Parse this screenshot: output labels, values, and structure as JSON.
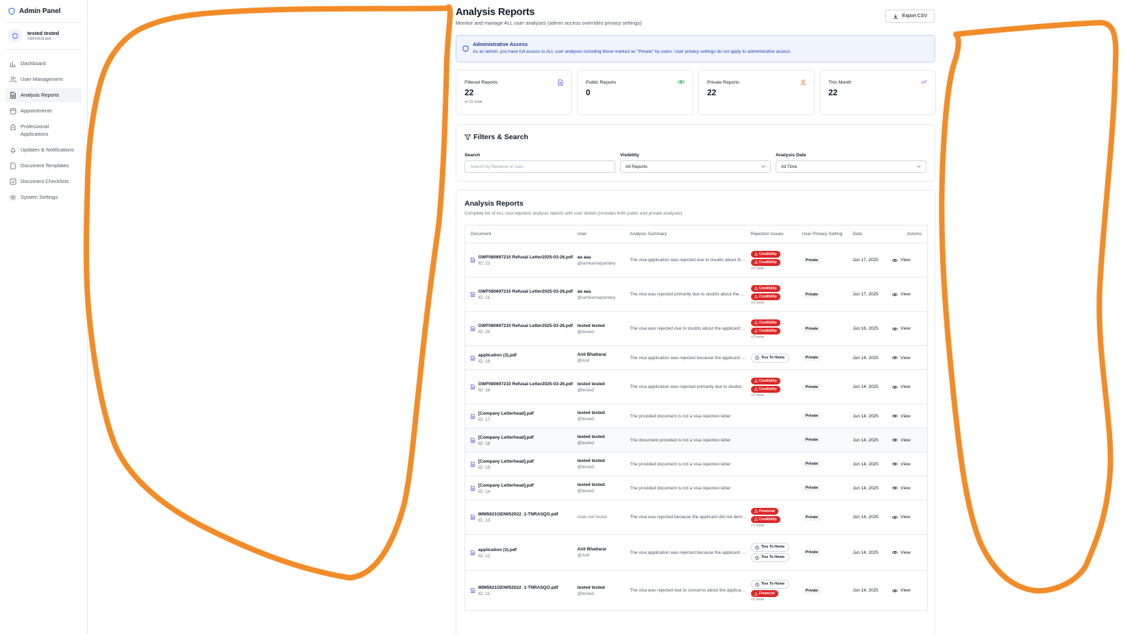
{
  "sidebar": {
    "brand": "Admin Panel",
    "user": {
      "name": "tested tested",
      "role": "Administrator"
    },
    "items": [
      {
        "label": "Dashboard",
        "icon": "bar-chart-icon",
        "active": false
      },
      {
        "label": "User Management",
        "icon": "users-icon",
        "active": false
      },
      {
        "label": "Analysis Reports",
        "icon": "file-text-icon",
        "active": true
      },
      {
        "label": "Appointments",
        "icon": "calendar-icon",
        "active": false
      },
      {
        "label": "Professional Applications",
        "icon": "building-icon",
        "active": false
      },
      {
        "label": "Updates & Notifications",
        "icon": "bell-icon",
        "active": false
      },
      {
        "label": "Document Templates",
        "icon": "file-icon",
        "active": false
      },
      {
        "label": "Document Checklists",
        "icon": "checkbox-icon",
        "active": false
      },
      {
        "label": "System Settings",
        "icon": "gear-icon",
        "active": false
      }
    ]
  },
  "header": {
    "title": "Analysis Reports",
    "subtitle": "Monitor and manage ALL user analyses (admin access overrides privacy settings)",
    "export_label": "Export CSV"
  },
  "alert": {
    "title": "Administrative Access",
    "text": "As an admin, you have full access to ALL user analyses including those marked as \"Private\" by users. User privacy settings do not apply to administrative access."
  },
  "stats": [
    {
      "label": "Filtered Reports",
      "value": "22",
      "note": "of 22 total",
      "icon": "document-icon",
      "color": "#4f46e5"
    },
    {
      "label": "Public Reports",
      "value": "0",
      "note": "",
      "icon": "eye-icon",
      "color": "#16a34a"
    },
    {
      "label": "Private Reports",
      "value": "22",
      "note": "",
      "icon": "user-icon",
      "color": "#ea580c"
    },
    {
      "label": "This Month",
      "value": "22",
      "note": "",
      "icon": "trending-icon",
      "color": "#7c3aed"
    }
  ],
  "filters": {
    "title": "Filters & Search",
    "search_label": "Search",
    "search_placeholder": "Search by filename or user...",
    "visibility_label": "Visibility",
    "visibility_value": "All Reports",
    "date_label": "Analysis Date",
    "date_value": "All Time"
  },
  "reports": {
    "title": "Analysis Reports",
    "subtitle": "Complete list of ALL visa rejection analysis reports with user details (includes both public and private analyses)",
    "columns": [
      "Document",
      "User",
      "Analysis Summary",
      "Rejection Issues",
      "User Privacy Setting",
      "Date",
      "Actions"
    ],
    "rows": [
      {
        "doc": "GWF080697210 Refusal Letter2025-03-26.pdf",
        "id": "ID: 22",
        "user": "aa aaa",
        "handle": "@iamkamalpandey",
        "summary": "The visa application was rejected due to doubts about the applicant's credibility",
        "issues": [
          {
            "label": "Credibility",
            "kind": "red"
          },
          {
            "label": "Credibility",
            "kind": "red"
          }
        ],
        "more": "+2 more",
        "privacy": "Private",
        "date": "Jun 17, 2025",
        "action": "View"
      },
      {
        "doc": "GWF080697210 Refusal Letter2025-03-26.pdf",
        "id": "ID: 21",
        "user": "aa aaa",
        "handle": "@iamkamalpandey",
        "summary": "The visa was rejected primarily due to doubts about the applicant",
        "issues": [
          {
            "label": "Credibility",
            "kind": "red"
          },
          {
            "label": "Credibility",
            "kind": "red"
          }
        ],
        "more": "+2 more",
        "privacy": "Private",
        "date": "Jun 17, 2025",
        "action": "View"
      },
      {
        "doc": "GWF080697210 Refusal Letter2025-03-26.pdf",
        "id": "ID: 20",
        "user": "tested tested",
        "handle": "@tested",
        "summary": "The visa was rejected due to doubts about the applicant's intentions",
        "issues": [
          {
            "label": "Credibility",
            "kind": "red"
          },
          {
            "label": "Credibility",
            "kind": "red"
          }
        ],
        "more": "+2 more",
        "privacy": "Private",
        "date": "Jun 16, 2025",
        "action": "View"
      },
      {
        "doc": "application (3).pdf",
        "id": "ID: 19",
        "user": "Anil Bhattarai",
        "handle": "@Anil",
        "summary": "The visa application was rejected because the applicant failed to",
        "issues": [
          {
            "label": "Ties To Home",
            "kind": "outline"
          }
        ],
        "more": "",
        "privacy": "Private",
        "date": "Jun 14, 2025",
        "action": "View"
      },
      {
        "doc": "GWF080697210 Refusal Letter2025-03-26.pdf",
        "id": "ID: 18",
        "user": "tested tested",
        "handle": "@tested",
        "summary": "The visa application was rejected primarily due to doubts",
        "issues": [
          {
            "label": "Credibility",
            "kind": "red"
          },
          {
            "label": "Credibility",
            "kind": "red"
          }
        ],
        "more": "+2 more",
        "privacy": "Private",
        "date": "Jun 14, 2025",
        "action": "View"
      },
      {
        "doc": "[Company Letterhead].pdf",
        "id": "ID: 17",
        "user": "tested tested",
        "handle": "@tested",
        "summary": "The provided document is not a visa rejection letter",
        "issues": [],
        "more": "",
        "privacy": "Private",
        "date": "Jun 14, 2025",
        "action": "View"
      },
      {
        "doc": "[Company Letterhead].pdf",
        "id": "ID: 16",
        "user": "tested tested",
        "handle": "@tested",
        "summary": "The document provided is not a visa rejection letter",
        "issues": [],
        "more": "",
        "privacy": "Private",
        "date": "Jun 14, 2025",
        "action": "View"
      },
      {
        "doc": "[Company Letterhead].pdf",
        "id": "ID: 15",
        "user": "tested tested",
        "handle": "@tested",
        "summary": "The provided document is not a visa rejection letter",
        "issues": [],
        "more": "",
        "privacy": "Private",
        "date": "Jun 14, 2025",
        "action": "View"
      },
      {
        "doc": "[Company Letterhead].pdf",
        "id": "ID: 14",
        "user": "tested tested",
        "handle": "@tested",
        "summary": "The provided document is not a visa rejection letter",
        "issues": [],
        "more": "",
        "privacy": "Private",
        "date": "Jun 14, 2025",
        "action": "View"
      },
      {
        "doc": "IMM5621GEN052022_1-TNRASQO.pdf",
        "id": "ID: 13",
        "user": "User not found",
        "handle": "",
        "summary": "The visa was rejected because the applicant did not demonstrate",
        "issues": [
          {
            "label": "Financial",
            "kind": "red"
          },
          {
            "label": "Credibility",
            "kind": "red"
          }
        ],
        "more": "+1 more",
        "privacy": "Private",
        "date": "Jun 14, 2025",
        "action": "View"
      },
      {
        "doc": "application (3).pdf",
        "id": "ID: 12",
        "user": "Anil Bhattarai",
        "handle": "@Anil",
        "summary": "The visa application was rejected because the applicant failed to",
        "issues": [
          {
            "label": "Ties To Home",
            "kind": "outline"
          },
          {
            "label": "Ties To Home",
            "kind": "outline"
          }
        ],
        "more": "",
        "privacy": "Private",
        "date": "Jun 14, 2025",
        "action": "View"
      },
      {
        "doc": "IMM5621GEN052022_1-TNRASQO.pdf",
        "id": "ID: 11",
        "user": "tested tested",
        "handle": "@tested",
        "summary": "The visa was rejected due to concerns about the applicant's ties",
        "issues": [
          {
            "label": "Ties To Home",
            "kind": "outline"
          },
          {
            "label": "Financial",
            "kind": "red"
          }
        ],
        "more": "+1 more",
        "privacy": "Private",
        "date": "Jun 14, 2025",
        "action": "View"
      }
    ]
  }
}
